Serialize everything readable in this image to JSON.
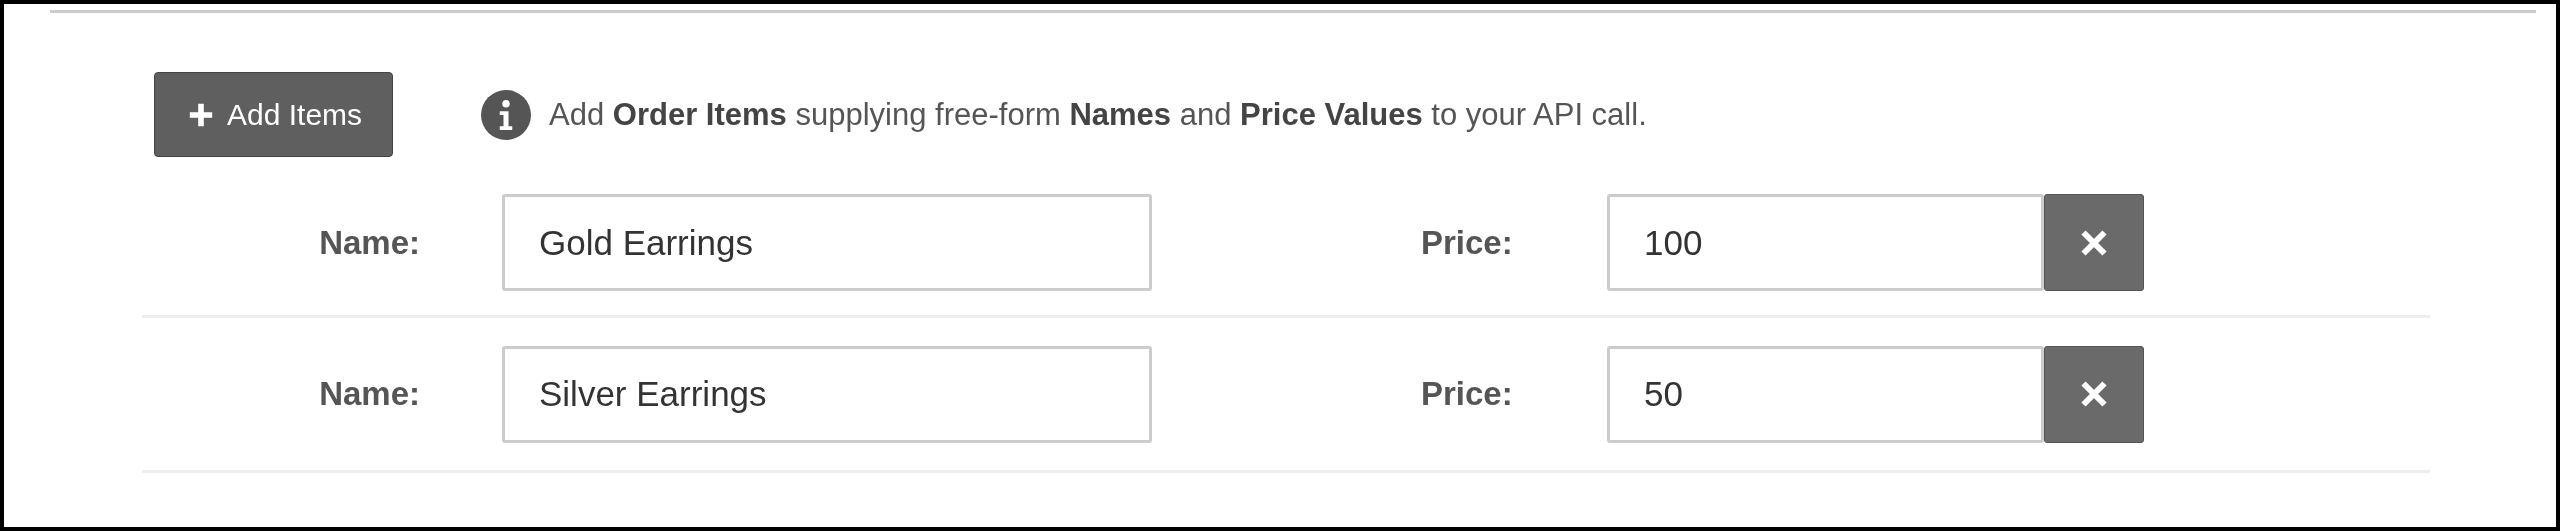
{
  "add_button": {
    "label": "Add Items"
  },
  "info": {
    "text": "Add **Order Items** supplying free-form **Names** and **Price Values** to your API call."
  },
  "items": [
    {
      "name_label": "Name:",
      "name": "Gold Earrings",
      "price_label": "Price:",
      "price": "100"
    },
    {
      "name_label": "Name:",
      "name": "Silver Earrings",
      "price_label": "Price:",
      "price": "50"
    }
  ]
}
